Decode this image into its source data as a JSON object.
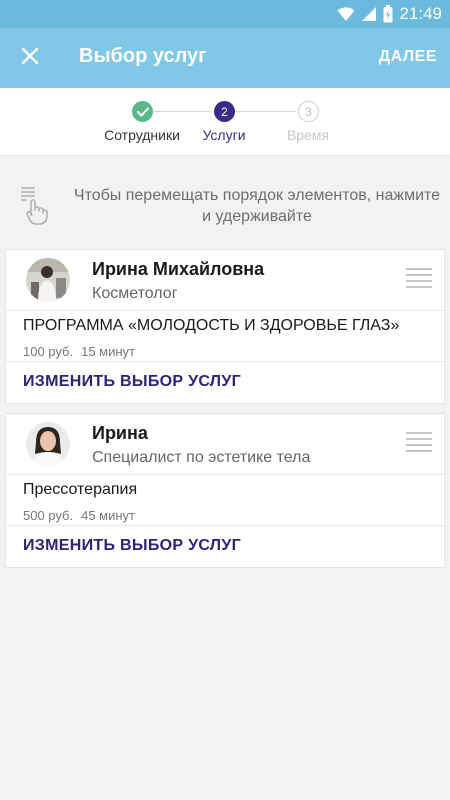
{
  "status_bar": {
    "time": "21:49"
  },
  "app_bar": {
    "title": "Выбор услуг",
    "next_label": "ДАЛЕЕ"
  },
  "stepper": {
    "steps": [
      {
        "label": "Сотрудники",
        "state": "done",
        "number": ""
      },
      {
        "label": "Услуги",
        "state": "active",
        "number": "2"
      },
      {
        "label": "Время",
        "state": "pending",
        "number": "3"
      }
    ]
  },
  "hint": {
    "text": "Чтобы перемещать порядок элементов, нажмите и удерживайте"
  },
  "cards": [
    {
      "employee_name": "Ирина Михайловна",
      "employee_role": "Косметолог",
      "service_name": "ПРОГРАММА «МОЛОДОСТЬ И ЗДОРОВЬЕ ГЛАЗ»",
      "price": "100 руб.",
      "duration": "15 минут",
      "change_label": "ИЗМЕНИТЬ ВЫБОР УСЛУГ"
    },
    {
      "employee_name": "Ирина",
      "employee_role": "Специалист по эстетике тела",
      "service_name": "Прессотерапия",
      "price": "500 руб.",
      "duration": "45 минут",
      "change_label": "ИЗМЕНИТЬ ВЫБОР УСЛУГ"
    }
  ],
  "colors": {
    "status_bar": "#6bb9dc",
    "app_bar": "#81c8e8",
    "step_done": "#59b98a",
    "step_active": "#3b2a86",
    "step_pending": "#c7c7c7",
    "link": "#2b2477"
  }
}
